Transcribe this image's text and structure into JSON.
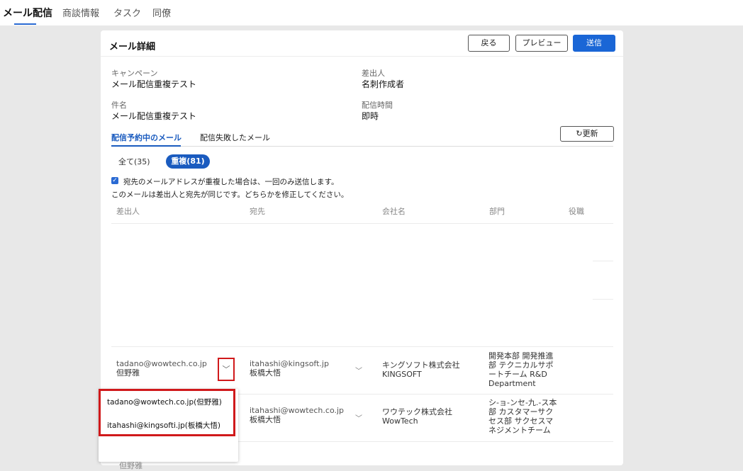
{
  "nav": {
    "items": [
      "メール配信",
      "商談情報",
      "タスク",
      "同僚"
    ]
  },
  "panel": {
    "title": "メール詳細",
    "buttons": {
      "back": "戻る",
      "preview": "プレビュー",
      "send": "送信"
    }
  },
  "fields": {
    "campaign_label": "キャンペーン",
    "campaign_value": "メール配信重複テスト",
    "sender_label": "差出人",
    "sender_value": "名刺作成者",
    "subject_label": "件名",
    "subject_value": "メール配信重複テスト",
    "time_label": "配信時間",
    "time_value": "即時"
  },
  "tabs": {
    "scheduled": "配信予約中のメール",
    "failed": "配信失敗したメール",
    "refresh": "更新"
  },
  "filters": {
    "all": "全て(35)",
    "dup": "重複(81)"
  },
  "notes": {
    "checkbox_label": "宛先のメールアドレスが重複した場合は、一回のみ送信します。",
    "warning": "このメールは差出人と宛先が同じです。どちらかを修正してください。"
  },
  "table": {
    "headers": [
      "差出人",
      "宛先",
      "会社名",
      "部門",
      "役職"
    ],
    "rows": [
      {
        "sender_email": "tadano@wowtech.co.jp",
        "sender_name": "但野雅",
        "recipient_email": "itahashi@kingsoft.jp",
        "recipient_name": "板橋大悟",
        "company": "キングソフト株式会社 KINGSOFT",
        "department": "開発本部 開発推進部 テクニカルサポートチーム R&D Department",
        "title": ""
      },
      {
        "sender_email": "",
        "sender_name": "",
        "recipient_email": "itahashi@wowtech.co.jp",
        "recipient_name": "板橋大悟",
        "company": "ワウテック株式会社 WowTech",
        "department": "シ-ョ-ンセ-九.-ス本部 カスタマーサクセス部 サクセスマネジメントチーム",
        "title": ""
      }
    ],
    "clipped_name": "但野雅"
  },
  "dropdown": {
    "options": [
      "tadano@wowtech.co.jp(但野雅)",
      "itahashi@kingsofti.jp(板橋大悟)"
    ]
  },
  "colors": {
    "accent": "#1a66d6",
    "highlight": "#d0191b"
  },
  "icons": {
    "chevron": "chevron-down-icon",
    "refresh": "refresh-icon",
    "check": "check-icon"
  }
}
